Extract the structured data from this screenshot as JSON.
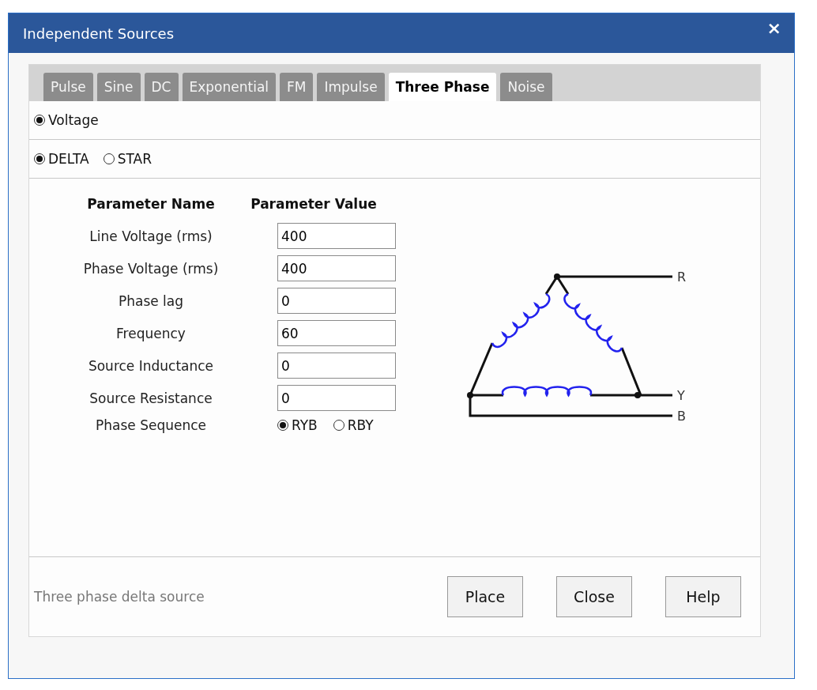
{
  "window": {
    "title": "Independent Sources",
    "close": "×"
  },
  "tabs": [
    {
      "label": "Pulse",
      "selected": false
    },
    {
      "label": "Sine",
      "selected": false
    },
    {
      "label": "DC",
      "selected": false
    },
    {
      "label": "Exponential",
      "selected": false
    },
    {
      "label": "FM",
      "selected": false
    },
    {
      "label": "Impulse",
      "selected": false
    },
    {
      "label": "Three Phase",
      "selected": true
    },
    {
      "label": "Noise",
      "selected": false
    }
  ],
  "source_type": [
    {
      "label": "Voltage",
      "selected": true
    }
  ],
  "connection": [
    {
      "label": "DELTA",
      "selected": true
    },
    {
      "label": "STAR",
      "selected": false
    }
  ],
  "parameters": {
    "columns": [
      "Parameter Name",
      "Parameter Value"
    ],
    "rows": [
      {
        "name": "Line Voltage (rms)",
        "value": "400"
      },
      {
        "name": "Phase Voltage (rms)",
        "value": "400"
      },
      {
        "name": "Phase lag",
        "value": "0"
      },
      {
        "name": "Frequency",
        "value": "60"
      },
      {
        "name": "Source Inductance",
        "value": "0"
      },
      {
        "name": "Source Resistance",
        "value": "0"
      }
    ],
    "phase_sequence": {
      "name": "Phase Sequence",
      "options": [
        {
          "label": "RYB",
          "selected": true
        },
        {
          "label": "RBY",
          "selected": false
        }
      ]
    }
  },
  "diagram": {
    "labels": [
      "R",
      "Y",
      "B"
    ]
  },
  "status": "Three phase delta source",
  "buttons": [
    "Place",
    "Close",
    "Help"
  ]
}
